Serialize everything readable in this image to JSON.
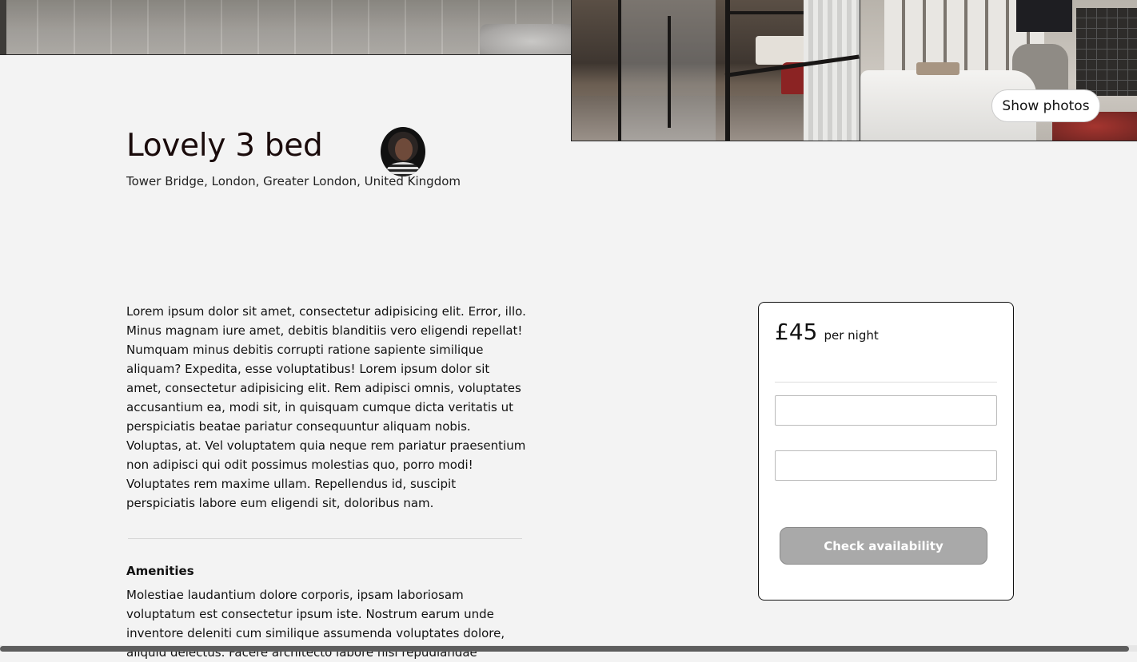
{
  "gallery": {
    "show_photos_label": "Show photos"
  },
  "listing": {
    "title": "Lovely 3 bed",
    "location": "Tower Bridge, London, Greater London, United Kingdom",
    "description": "Lorem ipsum dolor sit amet, consectetur adipisicing elit. Error, illo. Minus magnam iure amet, debitis blanditiis vero eligendi repellat! Numquam minus debitis corrupti ratione sapiente similique aliquam? Expedita, esse voluptatibus! Lorem ipsum dolor sit amet, consectetur adipisicing elit. Rem adipisci omnis, voluptates accusantium ea, modi sit, in quisquam cumque dicta veritatis ut perspiciatis beatae pariatur consequuntur aliquam nobis. Voluptas, at. Vel voluptatem quia neque rem pariatur praesentium non adipisci qui odit possimus molestias quo, porro modi! Voluptates rem maxime ullam. Repellendus id, suscipit perspiciatis labore eum eligendi sit, doloribus nam.",
    "amenities_heading": "Amenities",
    "amenities_text": "Molestiae laudantium dolore corporis, ipsam laboriosam voluptatum est consectetur ipsum iste. Nostrum earum unde inventore deleniti cum similique assumenda voluptates dolore, aliquid delectus. Facere architecto labore nisi repudiandae"
  },
  "booking": {
    "price": "£45",
    "price_unit": "per night",
    "check_in_value": "",
    "check_out_value": "",
    "check_availability_label": "Check availability",
    "button_color": "#a9a9a9"
  }
}
